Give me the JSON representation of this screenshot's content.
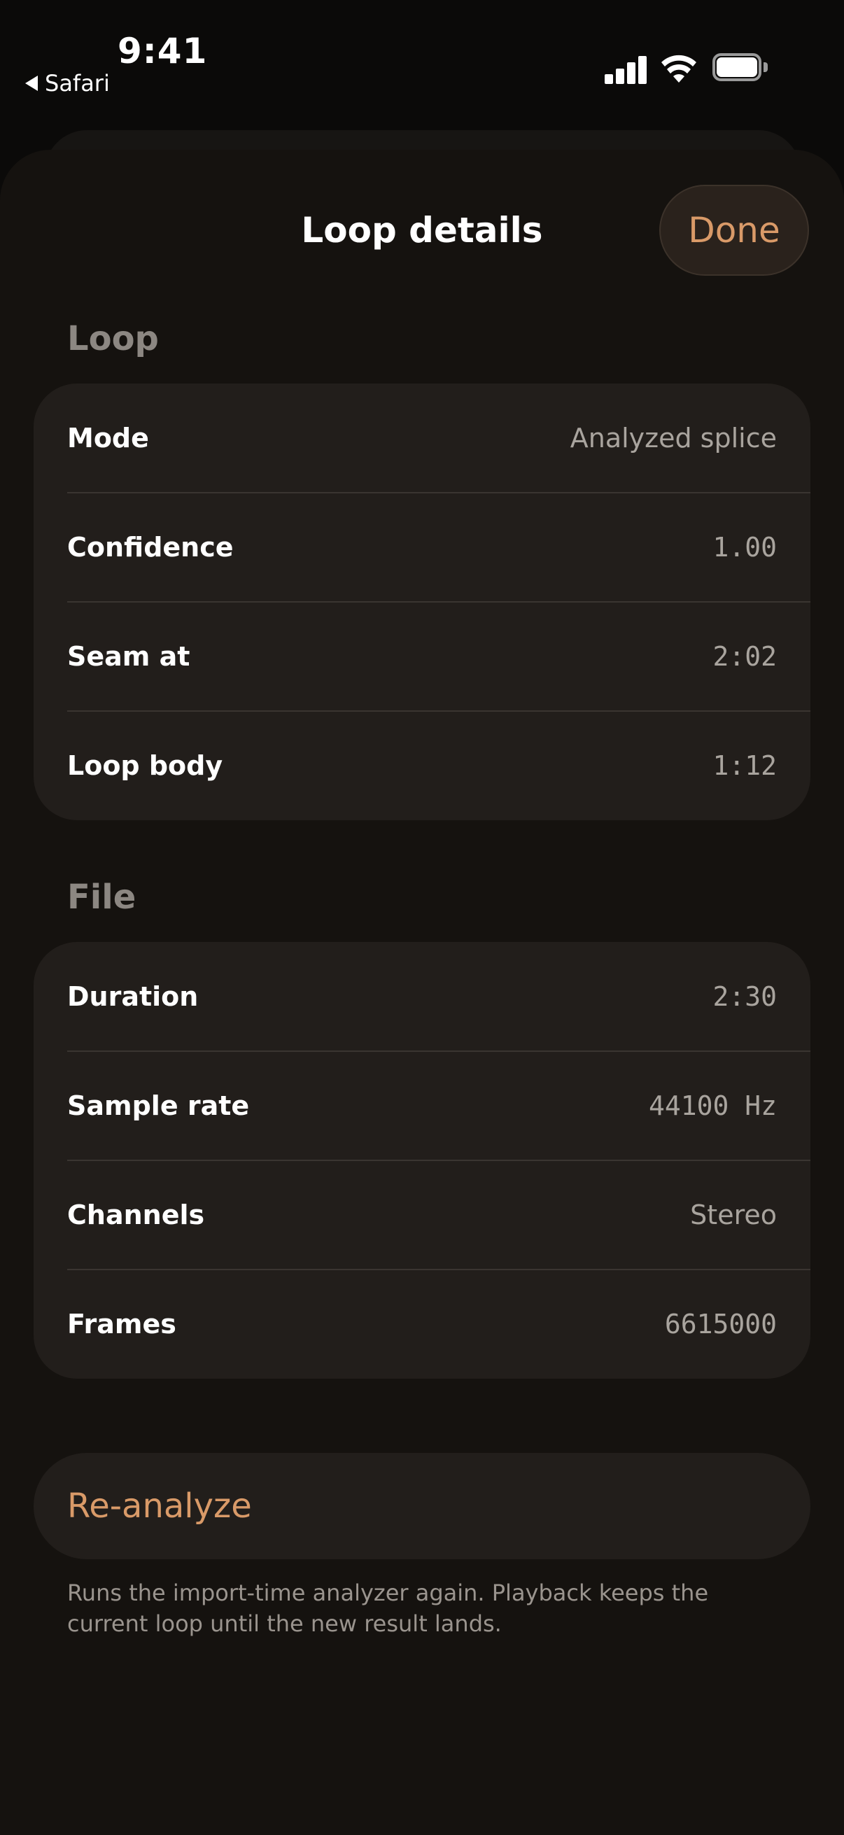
{
  "status_bar": {
    "time": "9:41",
    "back_app": "Safari",
    "icons": [
      "cellular-signal-icon",
      "wifi-icon",
      "battery-icon"
    ]
  },
  "header": {
    "title": "Loop details",
    "done_label": "Done"
  },
  "loop_section": {
    "title": "Loop",
    "rows": [
      {
        "label": "Mode",
        "value": "Analyzed splice"
      },
      {
        "label": "Confidence",
        "value": "1.00"
      },
      {
        "label": "Seam at",
        "value": "2:02"
      },
      {
        "label": "Loop body",
        "value": "1:12"
      }
    ]
  },
  "file_section": {
    "title": "File",
    "rows": [
      {
        "label": "Duration",
        "value": "2:30"
      },
      {
        "label": "Sample rate",
        "value": "44100 Hz"
      },
      {
        "label": "Channels",
        "value": "Stereo"
      },
      {
        "label": "Frames",
        "value": "6615000"
      }
    ]
  },
  "reanalyze": {
    "label": "Re-analyze",
    "note": "Runs the import-time analyzer again. Playback keeps the current loop until the new result lands."
  },
  "colors": {
    "accent": "#d99a68",
    "background": "#15120f",
    "card": "#221e1b",
    "secondary_text": "#a9a49e"
  }
}
